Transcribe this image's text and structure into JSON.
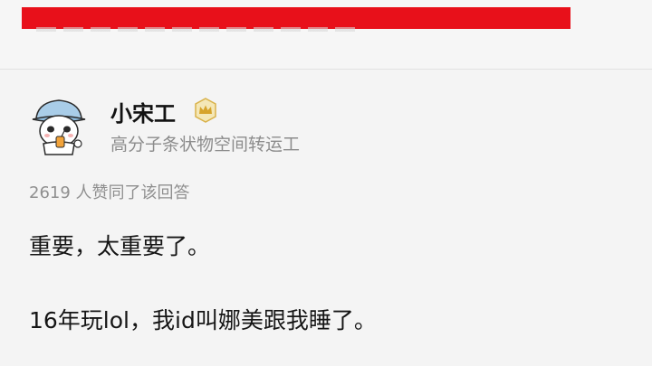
{
  "header": {
    "redaction_color": "#e8101a"
  },
  "answer": {
    "author": {
      "name": "小宋工",
      "headline": "高分子条状物空间转运工",
      "avatar_icon": "panda-avatar-icon",
      "badge_icon": "crown-badge-icon"
    },
    "vote_info": "2619 人赞同了该回答",
    "paragraphs": [
      "重要，太重要了。",
      "16年玩lol，我id叫娜美跟我睡了。"
    ]
  }
}
